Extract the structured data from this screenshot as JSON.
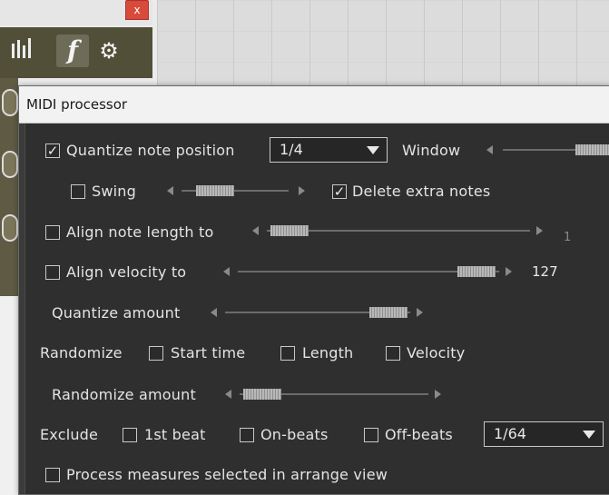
{
  "dialog": {
    "title": "MIDI processor"
  },
  "background": {
    "toolbar_icons": [
      "mixer-icon",
      "function-icon",
      "gear-icon"
    ],
    "function_glyph": "f",
    "close_tab": "x"
  },
  "quantize": {
    "label": "Quantize note position",
    "checked": true,
    "grid_value": "1/4",
    "window_label": "Window"
  },
  "swing": {
    "label": "Swing",
    "checked": false
  },
  "delete_extra": {
    "label": "Delete extra notes",
    "checked": true
  },
  "align_length": {
    "label": "Align note length to",
    "checked": false,
    "value": "1"
  },
  "align_velocity": {
    "label": "Align velocity to",
    "checked": false,
    "value": "127"
  },
  "quantize_amount": {
    "label": "Quantize amount"
  },
  "randomize": {
    "label": "Randomize",
    "start_time": "Start time",
    "length": "Length",
    "velocity": "Velocity"
  },
  "randomize_amount": {
    "label": "Randomize amount"
  },
  "exclude": {
    "label": "Exclude",
    "first_beat": "1st beat",
    "on_beats": "On-beats",
    "off_beats": "Off-beats",
    "grid_value": "1/64"
  },
  "process_measures": {
    "label": "Process measures selected in arrange view",
    "checked": false
  },
  "colors": {
    "dialog_bg": "#2f2f2f",
    "title_bg": "#f2f2f2",
    "text": "#e4e4e4",
    "slider_thumb": "#b8b8b8"
  }
}
